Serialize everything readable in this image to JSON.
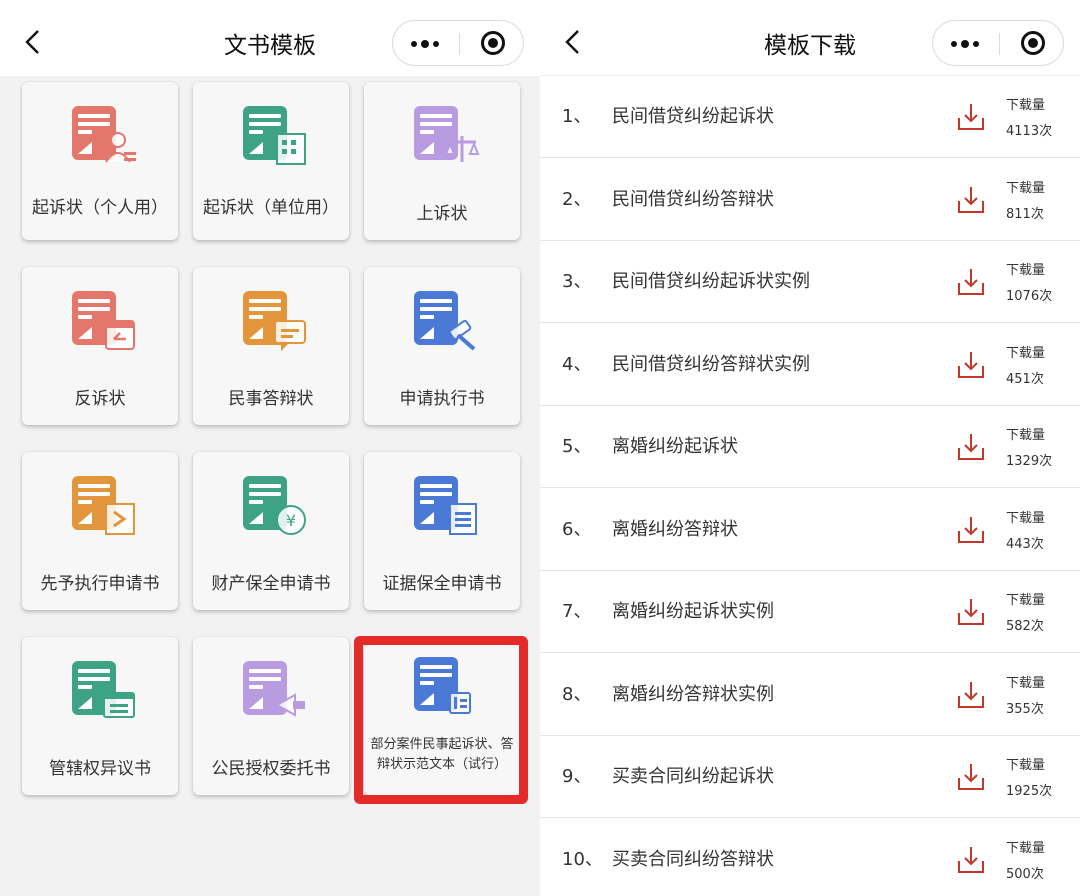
{
  "left_panel": {
    "title": "文书模板",
    "cards": [
      {
        "label": "起诉状（个人用）",
        "icon": "lawsuit-personal-icon",
        "color": "#e4776c"
      },
      {
        "label": "起诉状（单位用）",
        "icon": "lawsuit-company-icon",
        "color": "#3ea385"
      },
      {
        "label": "上诉状",
        "icon": "appeal-scale-icon",
        "color": "#b89be0"
      },
      {
        "label": "反诉状",
        "icon": "counterclaim-calendar-icon",
        "color": "#e4776c"
      },
      {
        "label": "民事答辩状",
        "icon": "defense-chat-icon",
        "color": "#e3953b"
      },
      {
        "label": "申请执行书",
        "icon": "execution-gavel-icon",
        "color": "#4a7ad6"
      },
      {
        "label": "先予执行申请书",
        "icon": "advance-execution-icon",
        "color": "#e3953b"
      },
      {
        "label": "财产保全申请书",
        "icon": "property-preservation-icon",
        "color": "#3ea385"
      },
      {
        "label": "证据保全申请书",
        "icon": "evidence-preservation-icon",
        "color": "#4a7ad6"
      },
      {
        "label": "管辖权异议书",
        "icon": "jurisdiction-objection-icon",
        "color": "#3ea385"
      },
      {
        "label": "公民授权委托书",
        "icon": "power-of-attorney-icon",
        "color": "#b89be0"
      },
      {
        "label": "部分案件民事起诉状、答辩状示范文本（试行）",
        "icon": "sample-text-icon",
        "color": "#4a7ad6"
      }
    ]
  },
  "right_panel": {
    "title": "模板下载",
    "download_count_label": "下载量",
    "items": [
      {
        "num": "1、",
        "name": "民间借贷纠纷起诉状",
        "count": "4113次"
      },
      {
        "num": "2、",
        "name": "民间借贷纠纷答辩状",
        "count": "811次"
      },
      {
        "num": "3、",
        "name": "民间借贷纠纷起诉状实例",
        "count": "1076次"
      },
      {
        "num": "4、",
        "name": "民间借贷纠纷答辩状实例",
        "count": "451次"
      },
      {
        "num": "5、",
        "name": "离婚纠纷起诉状",
        "count": "1329次"
      },
      {
        "num": "6、",
        "name": "离婚纠纷答辩状",
        "count": "443次"
      },
      {
        "num": "7、",
        "name": "离婚纠纷起诉状实例",
        "count": "582次"
      },
      {
        "num": "8、",
        "name": "离婚纠纷答辩状实例",
        "count": "355次"
      },
      {
        "num": "9、",
        "name": "买卖合同纠纷起诉状",
        "count": "1925次"
      },
      {
        "num": "10、",
        "name": "买卖合同纠纷答辩状",
        "count": "500次"
      }
    ]
  },
  "colors": {
    "highlight": "#e52a2a",
    "download_icon": "#c0392b"
  }
}
